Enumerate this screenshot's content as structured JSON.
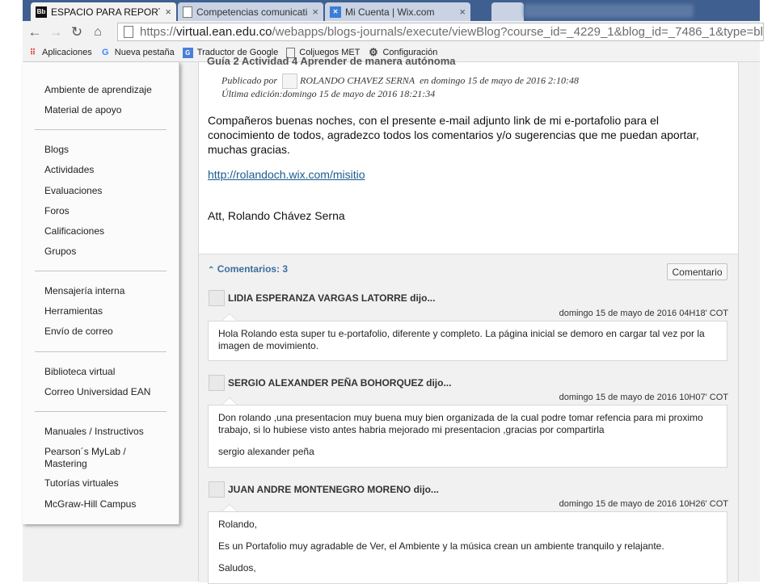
{
  "browser": {
    "tabs": [
      {
        "label": "ESPACIO PARA REPORTAR",
        "favicon": "Bb",
        "active": true
      },
      {
        "label": "Competencias comunicati",
        "favicon": "doc",
        "active": false
      },
      {
        "label": "Mi Cuenta | Wix.com",
        "favicon": "wix",
        "active": false
      }
    ],
    "close_glyph": "×",
    "url": {
      "scheme": "https://",
      "host": "virtual.ean.edu.co",
      "path": "/webapps/blogs-journals/execute/viewBlog?course_id=_4229_1&blog_id=_7486_1&type=blo"
    },
    "bookmarks": [
      {
        "label": "Aplicaciones",
        "icon": "apps-grid-icon"
      },
      {
        "label": "Nueva pestaña",
        "icon": "google-icon"
      },
      {
        "label": "Traductor de Google",
        "icon": "translate-icon"
      },
      {
        "label": "Coljuegos MET",
        "icon": "page-icon"
      },
      {
        "label": "Configuración",
        "icon": "gear-icon"
      }
    ]
  },
  "sidebar": {
    "groups": [
      [
        "Ambiente de aprendizaje",
        "Material de apoyo"
      ],
      [
        "Blogs",
        "Actividades",
        "Evaluaciones",
        "Foros",
        "Calificaciones",
        "Grupos"
      ],
      [
        "Mensajería interna",
        "Herramientas",
        "Envío de correo"
      ],
      [
        "Biblioteca virtual",
        "Correo Universidad EAN"
      ],
      [
        "Manuales / Instructivos",
        "Pearson´s MyLab / Mastering",
        "Tutorías virtuales",
        "McGraw-Hill Campus"
      ]
    ]
  },
  "entry": {
    "title_clip": "Guía 2 Actividad 4 Aprender de manera autónoma",
    "published_prefix": "Publicado por",
    "author": "ROLANDO CHAVEZ SERNA",
    "published_suffix": "en domingo 15 de mayo de 2016 2:10:48",
    "edited": "Última edición:domingo 15 de mayo de 2016 18:21:34",
    "body": "Compañeros buenas noches, con el presente e-mail adjunto link de mi e-portafolio para el conocimiento de todos, agradezco todos los comentarios y/o sugerencias que me puedan aportar, muchas gracias.",
    "link": "http://rolandoch.wix.com/misitio",
    "signature": "Att, Rolando Chávez Serna"
  },
  "comments": {
    "toggle_label": "Comentarios: 3",
    "toggle_glyph": "⌃",
    "button_label": "Comentario",
    "items": [
      {
        "author": "LIDIA ESPERANZA VARGAS LATORRE dijo...",
        "date": "domingo 15 de mayo de 2016 04H18' COT",
        "paragraphs": [
          "Hola Rolando esta super tu e-portafolio, diferente y completo. La página inicial se demoro en cargar tal vez por la imagen de movimiento."
        ]
      },
      {
        "author": "SERGIO ALEXANDER PEÑA BOHORQUEZ dijo...",
        "date": "domingo 15 de mayo de 2016 10H07' COT",
        "paragraphs": [
          "Don rolando ,una presentacion muy buena muy bien organizada de la cual podre tomar refencia para mi proximo trabajo, si lo hubiese visto antes habria mejorado mi presentacion ,gracias por compartirla",
          "sergio alexander peña"
        ]
      },
      {
        "author": "JUAN ANDRE MONTENEGRO MORENO dijo...",
        "date": "domingo 15 de mayo de 2016 10H26' COT",
        "paragraphs": [
          "Rolando,",
          "Es un Portafolio muy agradable de Ver, el Ambiente y la música crean un ambiente tranquilo y relajante.",
          "Saludos,"
        ]
      }
    ]
  },
  "colors": {
    "tabstrip": "#3f5f90",
    "link": "#1a5b8f",
    "accent_blue": "#3b6e9e"
  }
}
